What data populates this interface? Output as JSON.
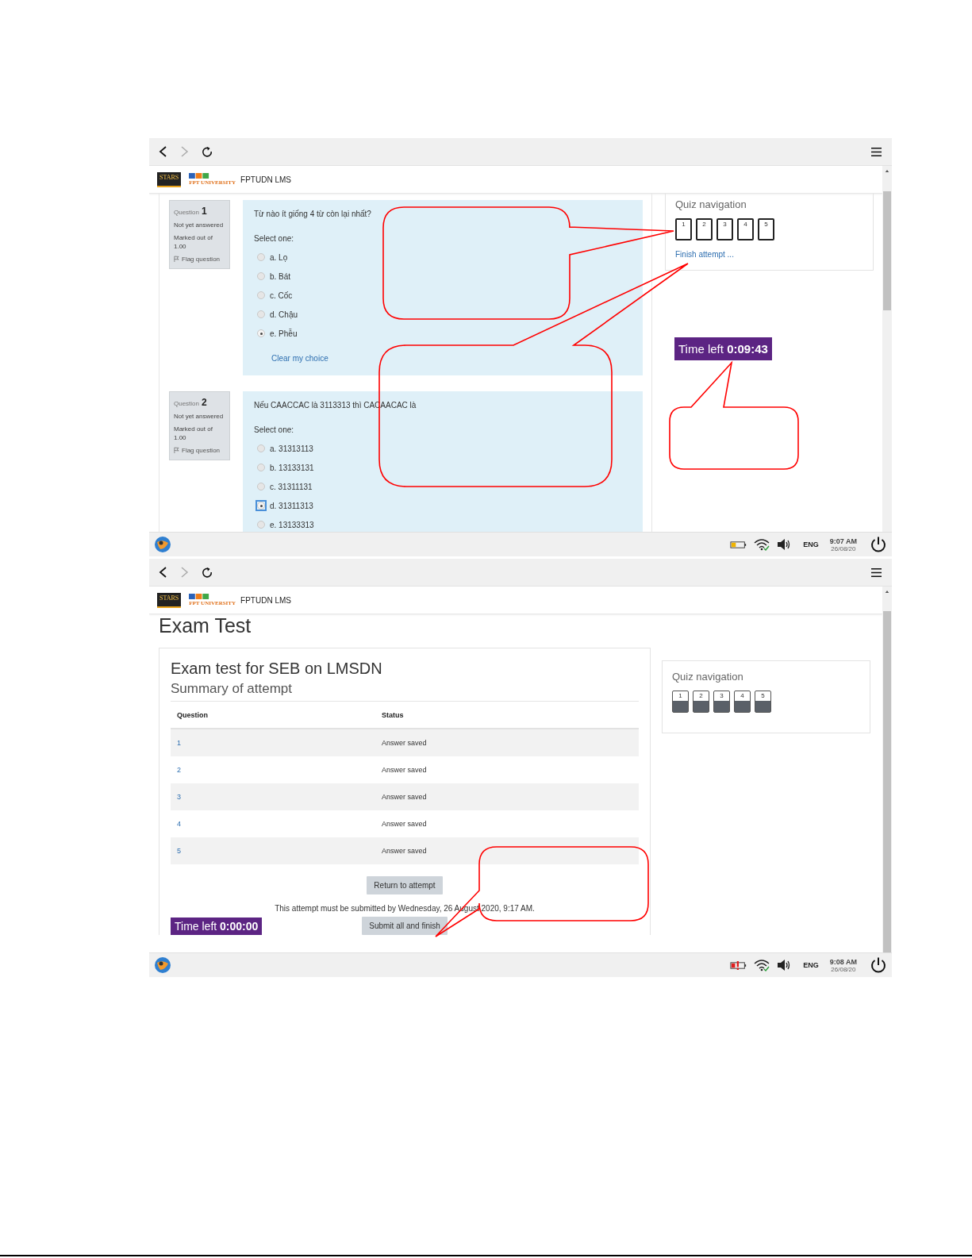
{
  "screens": [
    {
      "kind": "quiz_attempt",
      "browser": {
        "logo_badge": "STARS",
        "logo_school": "FPT UNIVERSITY",
        "site_name": "FPTUDN LMS"
      },
      "questions": [
        {
          "label": "Question",
          "number": "1",
          "status": "Not yet answered",
          "marks": "Marked out of 1.00",
          "flag": "Flag question",
          "text": "Từ nào ít giống 4 từ còn lại nhất?",
          "select_label": "Select one:",
          "options": [
            {
              "label": "a. Lọ",
              "selected": false,
              "focused": false
            },
            {
              "label": "b. Bát",
              "selected": false,
              "focused": false
            },
            {
              "label": "c. Cốc",
              "selected": false,
              "focused": false
            },
            {
              "label": "d. Chậu",
              "selected": false,
              "focused": false
            },
            {
              "label": "e. Phễu",
              "selected": true,
              "focused": false
            }
          ],
          "clear_link": "Clear my choice"
        },
        {
          "label": "Question",
          "number": "2",
          "status": "Not yet answered",
          "marks": "Marked out of 1.00",
          "flag": "Flag question",
          "text": "Nếu CAACCAC là 3113313 thì CACAACAC là",
          "select_label": "Select one:",
          "options": [
            {
              "label": "a. 31313113",
              "selected": false,
              "focused": false
            },
            {
              "label": "b. 13133131",
              "selected": false,
              "focused": false
            },
            {
              "label": "c. 31311131",
              "selected": false,
              "focused": false
            },
            {
              "label": "d. 31311313",
              "selected": true,
              "focused": true
            },
            {
              "label": "e. 13133313",
              "selected": false,
              "focused": false
            }
          ]
        }
      ],
      "quiz_navigation": {
        "title": "Quiz navigation",
        "buttons": [
          {
            "label": "1",
            "answered": false
          },
          {
            "label": "2",
            "answered": false
          },
          {
            "label": "3",
            "answered": false
          },
          {
            "label": "4",
            "answered": false
          },
          {
            "label": "5",
            "answered": false
          }
        ],
        "finish_link": "Finish attempt ..."
      },
      "timer": {
        "text": "Time left **0:09:43**"
      },
      "taskbar": {
        "battery_alert": false,
        "language": "ENG",
        "time": "9:07 AM",
        "date": "26/08/20"
      }
    },
    {
      "kind": "attempt_summary",
      "browser": {
        "logo_badge": "STARS",
        "logo_school": "FPT UNIVERSITY",
        "site_name": "FPTUDN LMS"
      },
      "page_title": "Exam Test",
      "quiz_title": "Exam test for SEB on LMSDN",
      "summary_title": "Summary of attempt",
      "table": {
        "columns": [
          "Question",
          "Status"
        ],
        "rows": [
          {
            "question": "1",
            "status": "Answer saved"
          },
          {
            "question": "2",
            "status": "Answer saved"
          },
          {
            "question": "3",
            "status": "Answer saved"
          },
          {
            "question": "4",
            "status": "Answer saved"
          },
          {
            "question": "5",
            "status": "Answer saved"
          }
        ]
      },
      "return_button": "Return to attempt",
      "deadline_note": "This attempt must be submitted by Wednesday, 26 August 2020, 9:17 AM.",
      "submit_button": "Submit all and finish",
      "timer": {
        "text": "Time left **0:00:00**"
      },
      "quiz_navigation": {
        "title": "Quiz navigation",
        "buttons": [
          {
            "label": "1",
            "answered": true
          },
          {
            "label": "2",
            "answered": true
          },
          {
            "label": "3",
            "answered": true
          },
          {
            "label": "4",
            "answered": true
          },
          {
            "label": "5",
            "answered": true
          }
        ]
      },
      "taskbar": {
        "battery_alert": true,
        "language": "ENG",
        "time": "9:08 AM",
        "date": "26/08/20"
      }
    }
  ]
}
